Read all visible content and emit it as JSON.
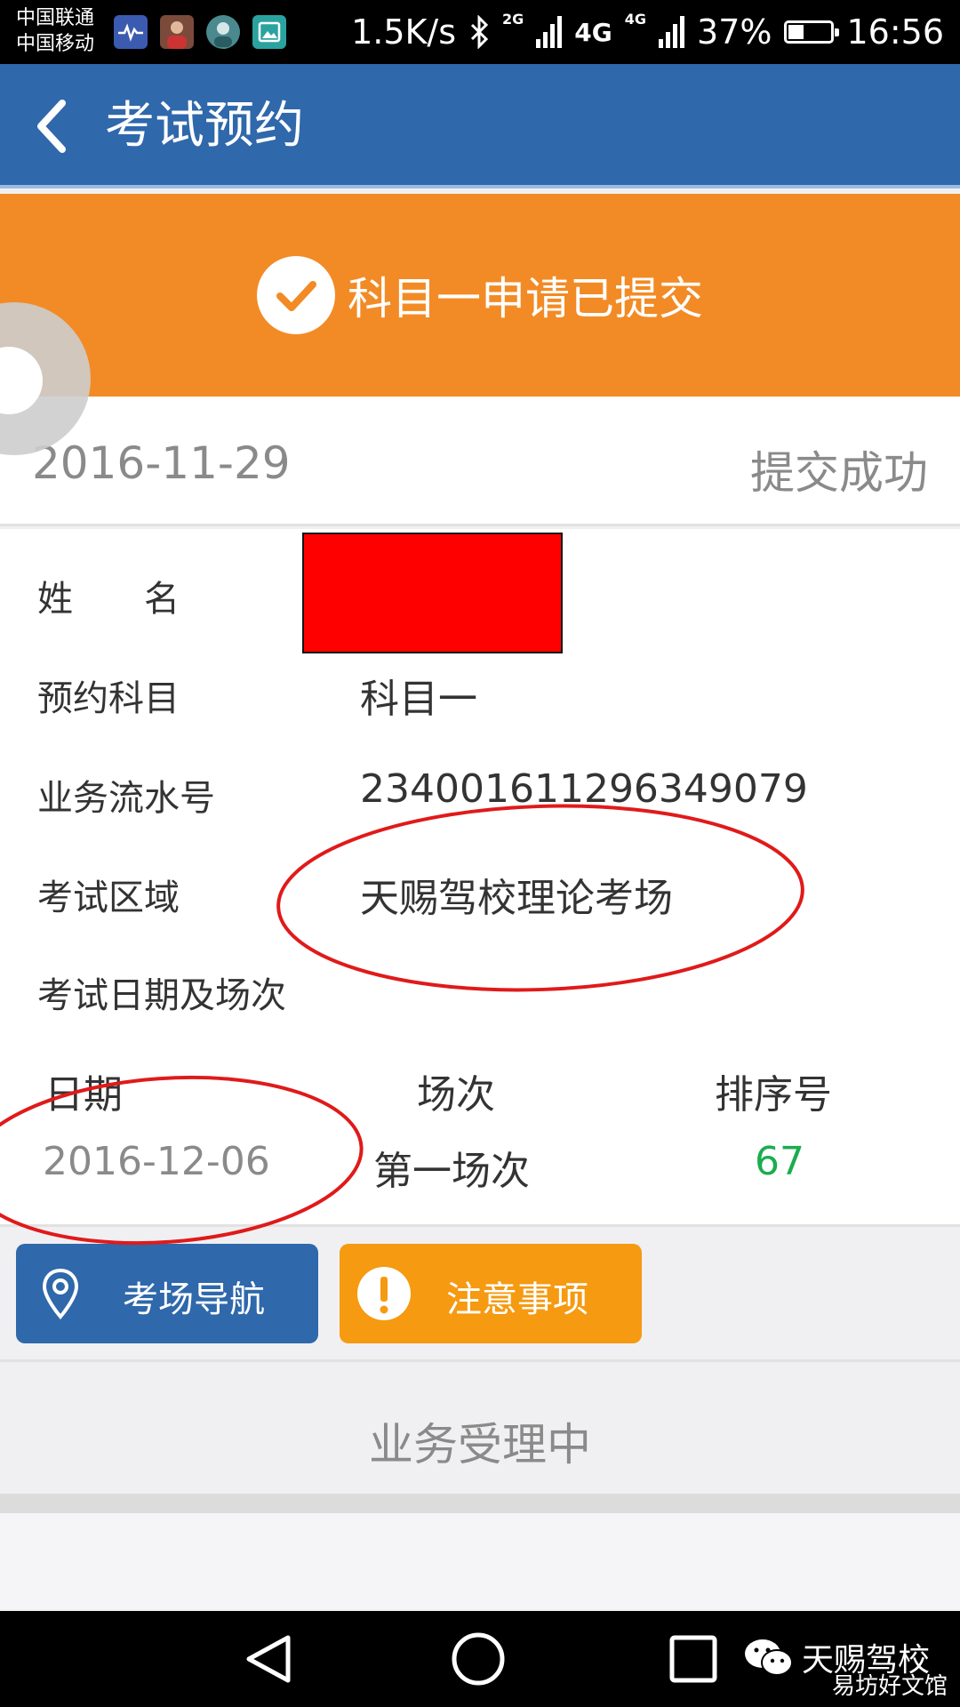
{
  "status_bar": {
    "carrier_1": "中国联通",
    "carrier_2": "中国移动",
    "net_speed": "1.5K/s",
    "gen_2g": "2G",
    "gen_4g_1": "4G",
    "gen_4g_2": "4G",
    "battery": "37%",
    "battery_level": 0.37,
    "time": "16:56"
  },
  "app_bar": {
    "title": "考试预约"
  },
  "banner": {
    "message": "科目一申请已提交"
  },
  "submission": {
    "date": "2016-11-29",
    "status": "提交成功"
  },
  "details": {
    "name_label": "姓　　名",
    "subject_label": "预约科目",
    "subject_value": "科目一",
    "serial_label": "业务流水号",
    "serial_value": "234001611296349079",
    "area_label": "考试区域",
    "area_value": "天赐驾校理论考场",
    "schedule_label": "考试日期及场次"
  },
  "schedule_table": {
    "headers": [
      "日期",
      "场次",
      "排序号"
    ],
    "rows": [
      {
        "date": "2016-12-06",
        "session": "第一场次",
        "order": "67"
      }
    ]
  },
  "buttons": {
    "nav_label": "考场导航",
    "notice_label": "注意事项"
  },
  "processing_status": "业务受理中",
  "watermark": {
    "name": "天赐驾校",
    "site": "易坊好文馆"
  },
  "colors": {
    "app_bar": "#2f68ab",
    "banner": "#f28b25",
    "nav_button": "#2f68ab",
    "notice_button": "#f59a11",
    "order_number": "#1aad4f",
    "annotation": "#e01a1a"
  }
}
